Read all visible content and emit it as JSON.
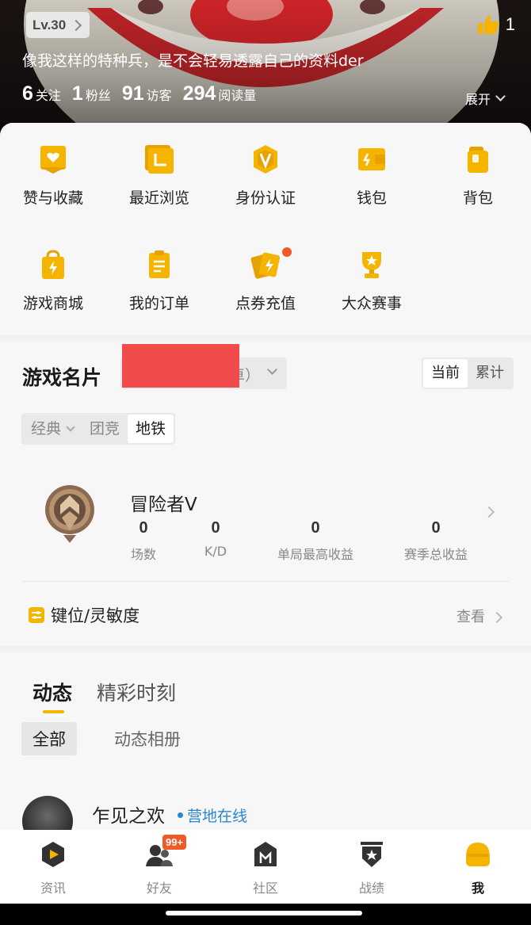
{
  "header": {
    "level": "Lv.30",
    "likes": "1",
    "signature": "像我这样的特种兵，是不会轻易透露自己的资料der",
    "stats": [
      {
        "value": "6",
        "label": "关注"
      },
      {
        "value": "1",
        "label": "粉丝"
      },
      {
        "value": "91",
        "label": "访客"
      },
      {
        "value": "294",
        "label": "阅读量"
      }
    ],
    "expand_label": "展开"
  },
  "menu": {
    "items": [
      {
        "label": "赞与收藏",
        "icon": "heart-card-icon"
      },
      {
        "label": "最近浏览",
        "icon": "recent-icon"
      },
      {
        "label": "身份认证",
        "icon": "verify-v-icon"
      },
      {
        "label": "钱包",
        "icon": "wallet-icon"
      },
      {
        "label": "背包",
        "icon": "backpack-icon"
      },
      {
        "label": "游戏商城",
        "icon": "shop-bag-icon"
      },
      {
        "label": "我的订单",
        "icon": "order-list-icon"
      },
      {
        "label": "点券充值",
        "icon": "coupon-recharge-icon"
      },
      {
        "label": "大众赛事",
        "icon": "trophy-icon"
      }
    ]
  },
  "game_card": {
    "title": "游戏名片",
    "server_suffix": "卓）",
    "view_toggle": [
      "当前",
      "累计"
    ],
    "modes": [
      "经典",
      "团竞",
      "地铁"
    ],
    "rank_name": "冒险者Ⅴ",
    "stats": [
      {
        "value": "0",
        "label": "场数"
      },
      {
        "value": "0",
        "label": "K/D"
      },
      {
        "value": "0",
        "label": "单局最高收益"
      },
      {
        "value": "0",
        "label": "赛季总收益"
      }
    ],
    "keys_label": "键位/灵敏度",
    "view_label": "查看"
  },
  "feed": {
    "tabs": [
      "动态",
      "精彩时刻"
    ],
    "subtabs": [
      "全部",
      "动态相册"
    ],
    "post_user": "乍见之欢",
    "online_status": "营地在线"
  },
  "tabbar": {
    "items": [
      {
        "label": "资讯",
        "icon": "news-play-icon"
      },
      {
        "label": "好友",
        "icon": "friends-icon"
      },
      {
        "label": "社区",
        "icon": "community-icon"
      },
      {
        "label": "战绩",
        "icon": "record-shield-icon"
      },
      {
        "label": "我",
        "icon": "me-helmet-icon"
      }
    ],
    "friends_badge": "99+"
  },
  "colors": {
    "accent": "#f5b400",
    "badge": "#f15a24",
    "online": "#2a86d1"
  }
}
